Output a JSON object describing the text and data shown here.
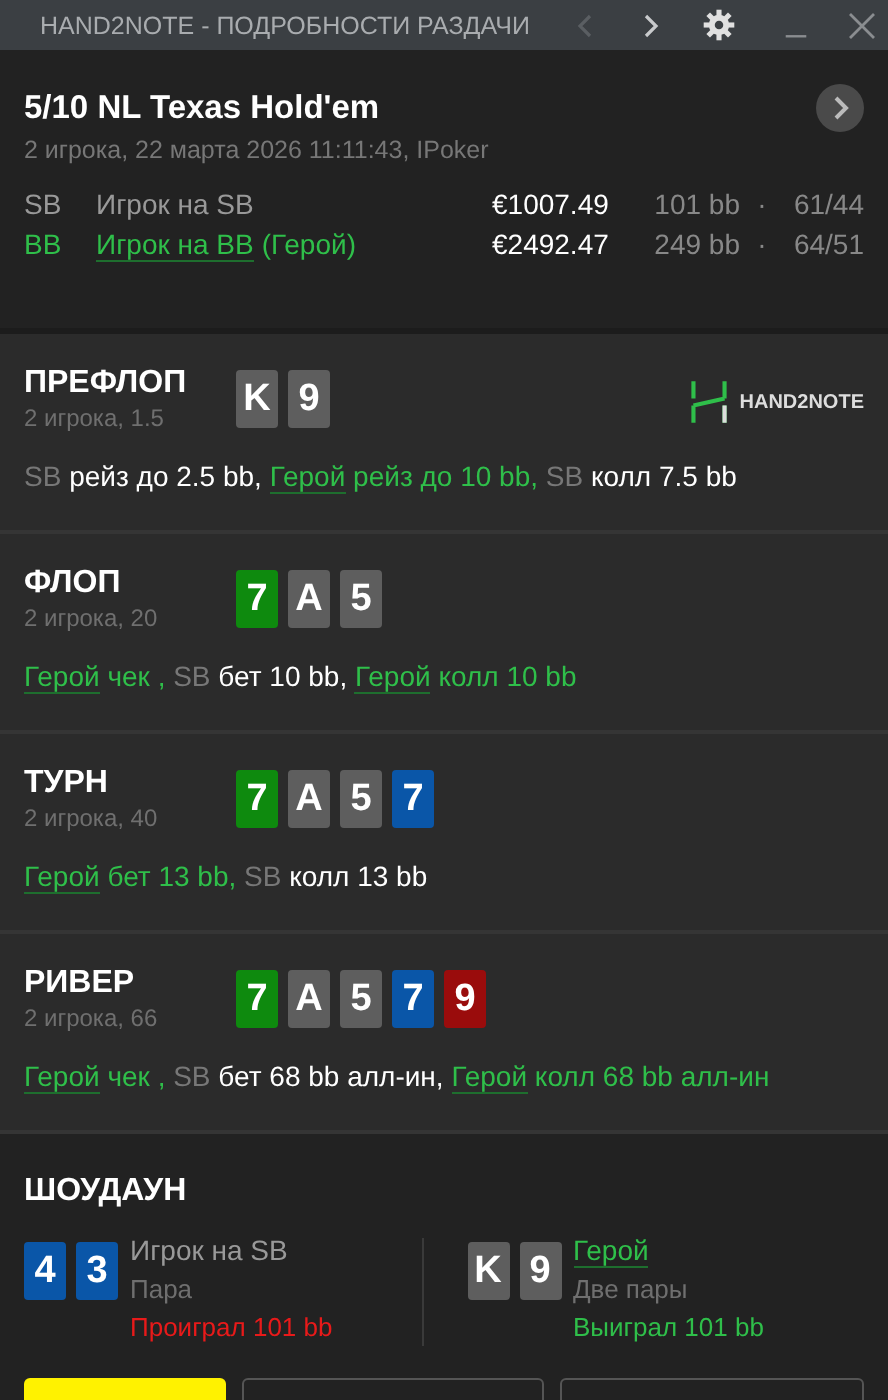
{
  "window": {
    "title": "HAND2NOTE - ПОДРОБНОСТИ РАЗДАЧИ"
  },
  "header": {
    "game": "5/10 NL Texas Hold'em",
    "info": "2 игрока, 22 марта 2026 11:11:43, IPoker",
    "players": [
      {
        "position": "SB",
        "name": "Игрок на SB",
        "hero": false,
        "stack": "€1007.49",
        "bb": "101 bb",
        "separator": "·",
        "stats": "61/44"
      },
      {
        "position": "BB",
        "name": "Игрок на BB",
        "suffix": "(Герой)",
        "hero": true,
        "stack": "€2492.47",
        "bb": "249 bb",
        "separator": "·",
        "stats": "64/51"
      }
    ]
  },
  "streets": [
    {
      "name": "ПРЕФЛОП",
      "info": "2 игрока, 1.5",
      "logo": "HAND2NOTE",
      "cards": [
        {
          "rank": "K",
          "color": "#5e5e5e"
        },
        {
          "rank": "9",
          "color": "#5e5e5e"
        }
      ],
      "actions": [
        {
          "actor": "SB",
          "hero": false,
          "text": "рейз до 2.5 bb,"
        },
        {
          "actor": "Герой",
          "hero": true,
          "text": "рейз до 10 bb,"
        },
        {
          "actor": "SB",
          "hero": false,
          "text": "колл 7.5 bb"
        }
      ]
    },
    {
      "name": "ФЛОП",
      "info": "2 игрока, 20",
      "cards": [
        {
          "rank": "7",
          "color": "#0e8a0e"
        },
        {
          "rank": "A",
          "color": "#5e5e5e"
        },
        {
          "rank": "5",
          "color": "#5e5e5e"
        }
      ],
      "actions": [
        {
          "actor": "Герой",
          "hero": true,
          "text": "чек ,"
        },
        {
          "actor": "SB",
          "hero": false,
          "text": "бет 10 bb,"
        },
        {
          "actor": "Герой",
          "hero": true,
          "text": "колл 10 bb"
        }
      ]
    },
    {
      "name": "ТУРН",
      "info": "2 игрока, 40",
      "cards": [
        {
          "rank": "7",
          "color": "#0e8a0e"
        },
        {
          "rank": "A",
          "color": "#5e5e5e"
        },
        {
          "rank": "5",
          "color": "#5e5e5e"
        },
        {
          "rank": "7",
          "color": "#0a56a8"
        }
      ],
      "actions": [
        {
          "actor": "Герой",
          "hero": true,
          "text": "бет 13 bb,"
        },
        {
          "actor": "SB",
          "hero": false,
          "text": "колл 13 bb"
        }
      ]
    },
    {
      "name": "РИВЕР",
      "info": "2 игрока, 66",
      "cards": [
        {
          "rank": "7",
          "color": "#0e8a0e"
        },
        {
          "rank": "A",
          "color": "#5e5e5e"
        },
        {
          "rank": "5",
          "color": "#5e5e5e"
        },
        {
          "rank": "7",
          "color": "#0a56a8"
        },
        {
          "rank": "9",
          "color": "#9a0c0c"
        }
      ],
      "actions": [
        {
          "actor": "Герой",
          "hero": true,
          "text": "чек ,"
        },
        {
          "actor": "SB",
          "hero": false,
          "text": "бет 68 bb алл-ин,"
        },
        {
          "actor": "Герой",
          "hero": true,
          "text": "колл 68 bb алл-ин"
        }
      ]
    }
  ],
  "showdown": {
    "title": "ШОУДАУН",
    "hands": [
      {
        "cards": [
          {
            "rank": "4",
            "color": "#0a56a8"
          },
          {
            "rank": "3",
            "color": "#0a56a8"
          }
        ],
        "player": "Игрок на SB",
        "hero": false,
        "combo": "Пара",
        "result": "Проиграл 101 bb",
        "won": false
      },
      {
        "cards": [
          {
            "rank": "K",
            "color": "#5e5e5e"
          },
          {
            "rank": "9",
            "color": "#5e5e5e"
          }
        ],
        "player": "Герой",
        "hero": true,
        "combo": "Две пары",
        "result": "Выиграл 101 bb",
        "won": true
      }
    ]
  }
}
